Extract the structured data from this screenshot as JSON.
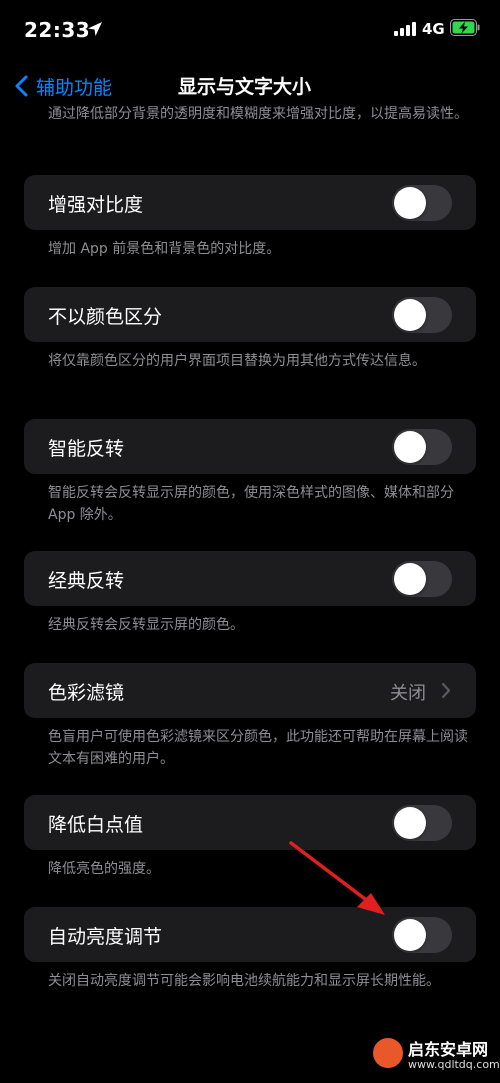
{
  "status_bar": {
    "time": "22:33",
    "network": "4G"
  },
  "nav": {
    "back_label": "辅助功能",
    "title": "显示与文字大小"
  },
  "top_description": "通过降低部分背景的透明度和模糊度来增强对比度，以提高易读性。",
  "settings": [
    {
      "label": "增强对比度",
      "description": "增加 App 前景色和背景色的对比度。",
      "on": false
    },
    {
      "label": "不以颜色区分",
      "description": "将仅靠颜色区分的用户界面项目替换为用其他方式传达信息。",
      "on": false
    },
    {
      "label": "智能反转",
      "description": "智能反转会反转显示屏的颜色，使用深色样式的图像、媒体和部分 App 除外。",
      "on": false
    },
    {
      "label": "经典反转",
      "description": "经典反转会反转显示屏的颜色。",
      "on": false
    },
    {
      "label": "色彩滤镜",
      "value": "关闭",
      "description": "色盲用户可使用色彩滤镜来区分颜色，此功能还可帮助在屏幕上阅读文本有困难的用户。"
    },
    {
      "label": "降低白点值",
      "description": "降低亮色的强度。",
      "on": false
    },
    {
      "label": "自动亮度调节",
      "description": "关闭自动亮度调节可能会影响电池续航能力和显示屏长期性能。",
      "on": false
    }
  ],
  "watermark": {
    "name": "启东安卓网",
    "url": "www.qdltdq.com"
  },
  "colors": {
    "accent": "#0a84ff",
    "cell": "#1c1c1e",
    "toggle_off": "#39393d",
    "annotation_arrow": "#e02020"
  }
}
